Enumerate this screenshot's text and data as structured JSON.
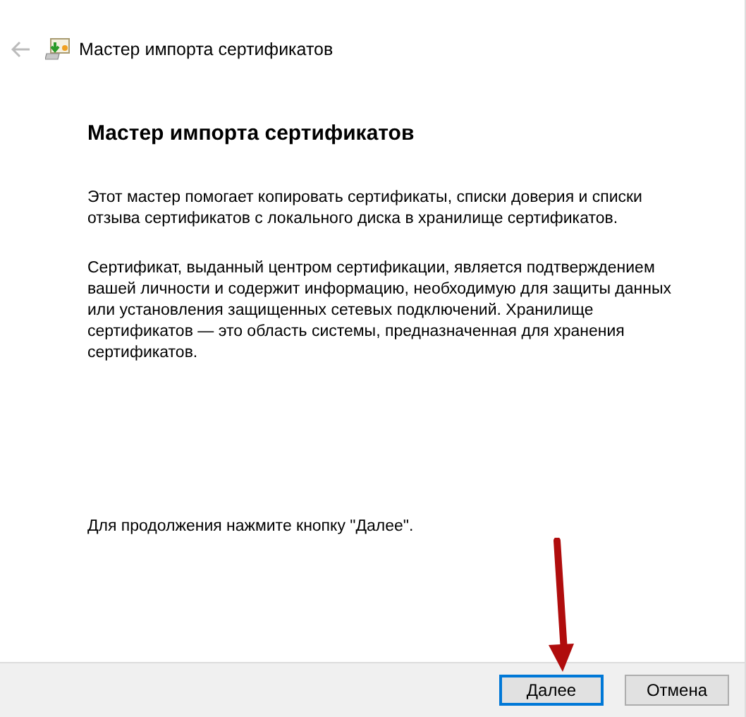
{
  "window": {
    "title": "Мастер импорта сертификатов",
    "back_enabled": false
  },
  "heading": "Мастер импорта сертификатов",
  "paragraphs": [
    "Этот мастер помогает копировать сертификаты, списки доверия и списки отзыва сертификатов с локального диска в хранилище сертификатов.",
    "Сертификат, выданный центром сертификации, является подтверждением вашей личности и содержит информацию, необходимую для защиты данных или установления защищенных сетевых подключений. Хранилище сертификатов — это область системы, предназначенная для хранения сертификатов."
  ],
  "footer_note": "Для продолжения нажмите кнопку \"Далее\".",
  "buttons": [
    {
      "label": "Далее",
      "default": true
    },
    {
      "label": "Отмена",
      "default": false
    }
  ]
}
